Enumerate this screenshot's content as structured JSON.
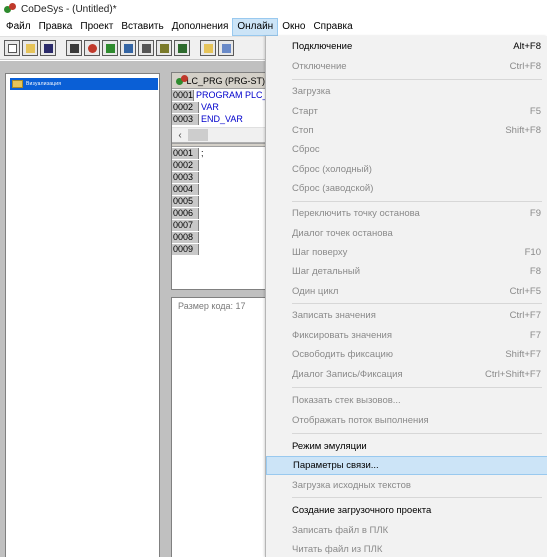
{
  "window": {
    "title": "CoDeSys - (Untitled)*"
  },
  "menubar": {
    "items": [
      "Файл",
      "Правка",
      "Проект",
      "Вставить",
      "Дополнения",
      "Онлайн",
      "Окно",
      "Справка"
    ],
    "active": "Онлайн"
  },
  "toolbar": {
    "icons": [
      "new-file-icon",
      "open-folder-icon",
      "save-icon",
      "build-icon",
      "stop-icon",
      "online-icon",
      "visualization-icon",
      "print-icon",
      "catalog-icon",
      "cut-icon",
      "copy-icon"
    ]
  },
  "tree": {
    "selected_item": "Визуализация"
  },
  "editor": {
    "title": "PLC_PRG (PRG-ST)",
    "decl_lines": [
      {
        "num": "0001",
        "code": "PROGRAM PLC_PRG"
      },
      {
        "num": "0002",
        "code": "VAR"
      },
      {
        "num": "0003",
        "code": "END_VAR"
      }
    ],
    "body_lines": [
      {
        "num": "0001",
        "code": ";"
      },
      {
        "num": "0002",
        "code": ""
      },
      {
        "num": "0003",
        "code": ""
      },
      {
        "num": "0004",
        "code": ""
      },
      {
        "num": "0005",
        "code": ""
      },
      {
        "num": "0006",
        "code": ""
      },
      {
        "num": "0007",
        "code": ""
      },
      {
        "num": "0008",
        "code": ""
      },
      {
        "num": "0009",
        "code": ""
      }
    ],
    "scroll_left": "‹"
  },
  "messages": {
    "text": "Размер кода: 17"
  },
  "online_menu": {
    "items": [
      {
        "label": "Подключение",
        "shortcut": "Alt+F8",
        "state": "enabled"
      },
      {
        "label": "Отключение",
        "shortcut": "Ctrl+F8",
        "state": "disabled"
      },
      {
        "label": "Загрузка",
        "shortcut": "",
        "state": "disabled"
      },
      {
        "label": "Старт",
        "shortcut": "F5",
        "state": "disabled"
      },
      {
        "label": "Стоп",
        "shortcut": "Shift+F8",
        "state": "disabled"
      },
      {
        "label": "Сброс",
        "shortcut": "",
        "state": "disabled"
      },
      {
        "label": "Сброс (холодный)",
        "shortcut": "",
        "state": "disabled"
      },
      {
        "label": "Сброс (заводской)",
        "shortcut": "",
        "state": "disabled"
      },
      {
        "label": "Переключить точку останова",
        "shortcut": "F9",
        "state": "disabled"
      },
      {
        "label": "Диалог точек останова",
        "shortcut": "",
        "state": "disabled"
      },
      {
        "label": "Шаг поверху",
        "shortcut": "F10",
        "state": "disabled"
      },
      {
        "label": "Шаг детальный",
        "shortcut": "F8",
        "state": "disabled"
      },
      {
        "label": "Один цикл",
        "shortcut": "Ctrl+F5",
        "state": "disabled"
      },
      {
        "label": "Записать значения",
        "shortcut": "Ctrl+F7",
        "state": "disabled"
      },
      {
        "label": "Фиксировать значения",
        "shortcut": "F7",
        "state": "disabled"
      },
      {
        "label": "Освободить фиксацию",
        "shortcut": "Shift+F7",
        "state": "disabled"
      },
      {
        "label": "Диалог Запись/Фиксация",
        "shortcut": "Ctrl+Shift+F7",
        "state": "disabled"
      },
      {
        "label": "Показать стек вызовов...",
        "shortcut": "",
        "state": "disabled"
      },
      {
        "label": "Отображать поток выполнения",
        "shortcut": "",
        "state": "disabled"
      },
      {
        "label": "Режим эмуляции",
        "shortcut": "",
        "state": "enabled"
      },
      {
        "label": "Параметры связи...",
        "shortcut": "",
        "state": "highlighted"
      },
      {
        "label": "Загрузка исходных текстов",
        "shortcut": "",
        "state": "disabled"
      },
      {
        "label": "Создание загрузочного проекта",
        "shortcut": "",
        "state": "enabled"
      },
      {
        "label": "Записать файл в ПЛК",
        "shortcut": "",
        "state": "disabled"
      },
      {
        "label": "Читать файл из ПЛК",
        "shortcut": "",
        "state": "disabled"
      }
    ]
  }
}
